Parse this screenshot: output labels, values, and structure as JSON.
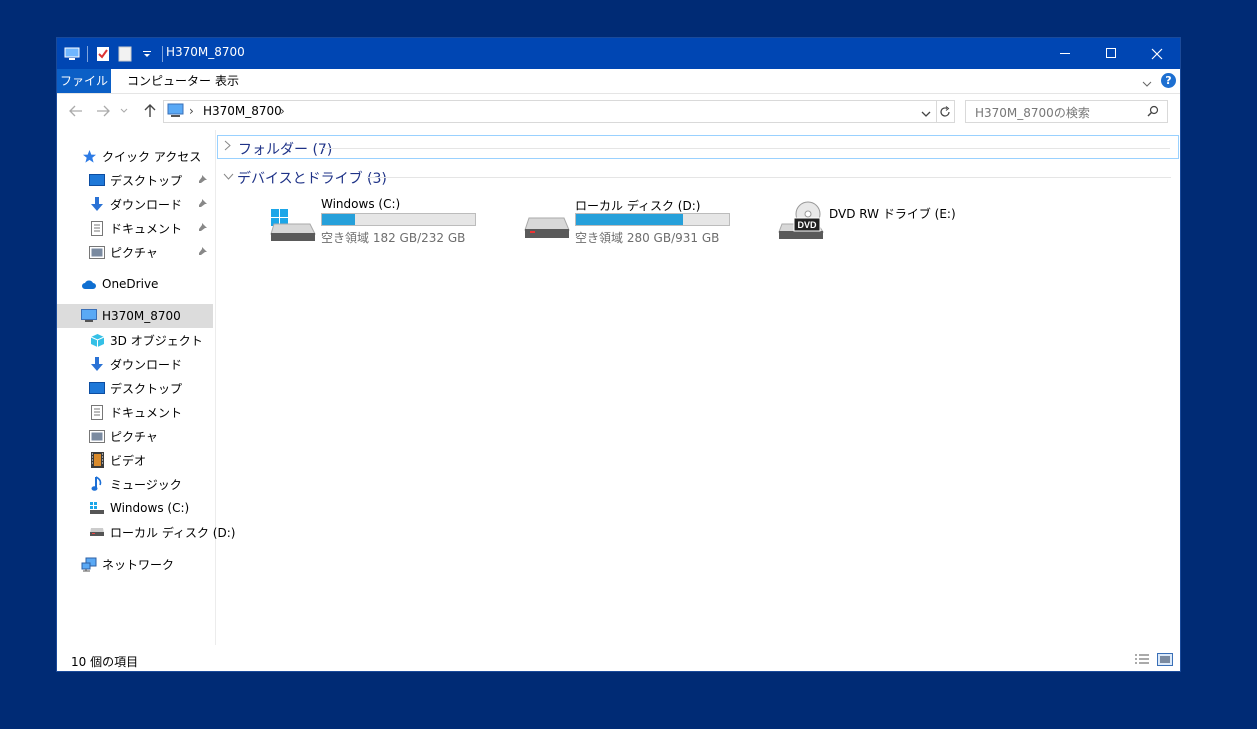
{
  "window": {
    "title": "H370M_8700"
  },
  "ribbon": {
    "tabs": [
      {
        "label": "ファイル"
      },
      {
        "label": "コンピューター"
      },
      {
        "label": "表示"
      }
    ]
  },
  "address": {
    "crumb": "H370M_8700"
  },
  "search": {
    "placeholder": "H370M_8700の検索"
  },
  "nav": {
    "quick_access": "クイック アクセス",
    "quick_items": [
      {
        "label": "デスクトップ"
      },
      {
        "label": "ダウンロード"
      },
      {
        "label": "ドキュメント"
      },
      {
        "label": "ピクチャ"
      }
    ],
    "onedrive": "OneDrive",
    "this_pc": "H370M_8700",
    "pc_items": [
      {
        "label": "3D オブジェクト"
      },
      {
        "label": "ダウンロード"
      },
      {
        "label": "デスクトップ"
      },
      {
        "label": "ドキュメント"
      },
      {
        "label": "ピクチャ"
      },
      {
        "label": "ビデオ"
      },
      {
        "label": "ミュージック"
      },
      {
        "label": "Windows (C:)"
      },
      {
        "label": "ローカル ディスク (D:)"
      }
    ],
    "network": "ネットワーク"
  },
  "groups": {
    "folders": "フォルダー (7)",
    "devices": "デバイスとドライブ (3)"
  },
  "drives": [
    {
      "name": "Windows (C:)",
      "free": "空き領域 182 GB/232 GB",
      "used_fraction": 0.216
    },
    {
      "name": "ローカル ディスク (D:)",
      "free": "空き領域 280 GB/931 GB",
      "used_fraction": 0.699
    },
    {
      "name": "DVD RW ドライブ (E:)",
      "badge": "DVD"
    }
  ],
  "status": {
    "count": "10 個の項目"
  },
  "colors": {
    "titlebar": "#0046b3",
    "desktop": "#002b75",
    "accent": "#26a0da",
    "group_text": "#1e3287"
  }
}
